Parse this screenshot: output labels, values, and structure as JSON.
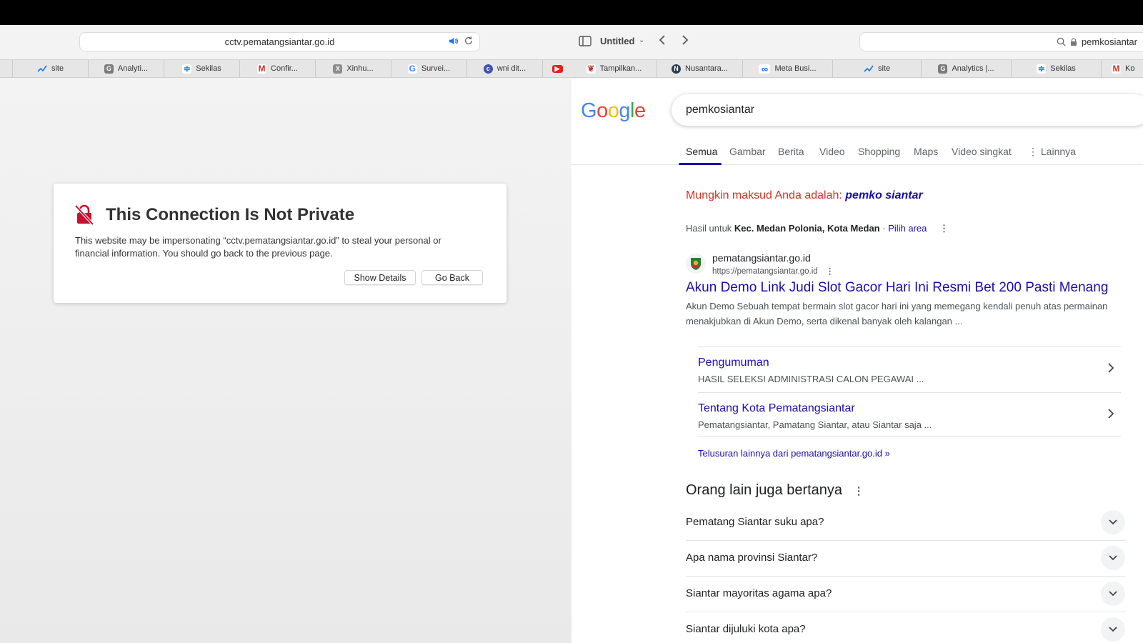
{
  "left_window": {
    "url": "cctv.pematangsiantar.go.id",
    "tabs": [
      {
        "label": "site",
        "icon": "trend-icon",
        "color": "#1a73e8"
      },
      {
        "label": "Analyti...",
        "icon": "analytics-icon",
        "color": "#7b7b7b"
      },
      {
        "label": "Sekilas",
        "icon": "sekilas-icon",
        "color": "#2b7bd3"
      },
      {
        "label": "Confir...",
        "icon": "gmail-icon",
        "color": "#d93025"
      },
      {
        "label": "Xinhu...",
        "icon": "xinhua-icon",
        "color": "#8c8c8c"
      },
      {
        "label": "Survei...",
        "icon": "google-icon",
        "color": "#4285f4"
      },
      {
        "label": "wni dit...",
        "icon": "c-icon",
        "color": "#3f51b5"
      },
      {
        "label": "",
        "icon": "youtube-icon",
        "color": "#e62117"
      }
    ],
    "dialog": {
      "title": "This Connection Is Not Private",
      "message": "This website may be impersonating “cctv.pematangsiantar.go.id” to steal your personal or financial information. You should go back to the previous page.",
      "show_details": "Show Details",
      "go_back": "Go Back"
    }
  },
  "right_window": {
    "tab_group": "Untitled",
    "url": "pemkosiantar",
    "tabs": [
      {
        "label": "Tampilkan...",
        "icon": "tampilkan-icon",
        "color": "#c0392b"
      },
      {
        "label": "Nusantara...",
        "icon": "nusantara-icon",
        "color": "#2c3e50"
      },
      {
        "label": "Meta Busi...",
        "icon": "meta-icon",
        "color": "#0866ff"
      },
      {
        "label": "site",
        "icon": "trend-icon",
        "color": "#1a73e8"
      },
      {
        "label": "Analytics |...",
        "icon": "analytics-icon",
        "color": "#7b7b7b"
      },
      {
        "label": "Sekilas",
        "icon": "sekilas-icon",
        "color": "#2b7bd3"
      },
      {
        "label": "Ko",
        "icon": "gmail-icon",
        "color": "#d93025"
      }
    ],
    "google": {
      "logo": "Google",
      "query": "pemkosiantar",
      "nav_tabs": [
        "Semua",
        "Gambar",
        "Berita",
        "Video",
        "Shopping",
        "Maps",
        "Video singkat",
        "Lainnya"
      ],
      "did_you_mean_prefix": "Mungkin maksud Anda adalah: ",
      "did_you_mean_term": "pemko siantar",
      "location_prefix": "Hasil untuk ",
      "location": "Kec. Medan Polonia, Kota Medan",
      "location_link": "· Pilih area",
      "result": {
        "site_name": "pematangsiantar.go.id",
        "site_url": "https://pematangsiantar.go.id",
        "title": "Akun Demo Link Judi Slot Gacor Hari Ini Resmi Bet 200 Pasti Menang",
        "snippet": "Akun Demo Sebuah tempat bermain slot gacor hari ini yang memegang kendali penuh atas permainan menakjubkan di Akun Demo, serta dikenal banyak oleh kalangan ...",
        "sitelinks": [
          {
            "title": "Pengumuman",
            "desc": "HASIL SELEKSI ADMINISTRASI CALON PEGAWAI ..."
          },
          {
            "title": "Tentang Kota Pematangsiantar",
            "desc": "Pematangsiantar, Pamatang Siantar, atau Siantar saja ..."
          }
        ],
        "more_link": "Telusuran lainnya dari pematangsiantar.go.id »"
      },
      "paa_heading": "Orang lain juga bertanya",
      "paa": [
        "Pematang Siantar suku apa?",
        "Apa nama provinsi Siantar?",
        "Siantar mayoritas agama apa?",
        "Siantar dijuluki kota apa?"
      ]
    }
  }
}
